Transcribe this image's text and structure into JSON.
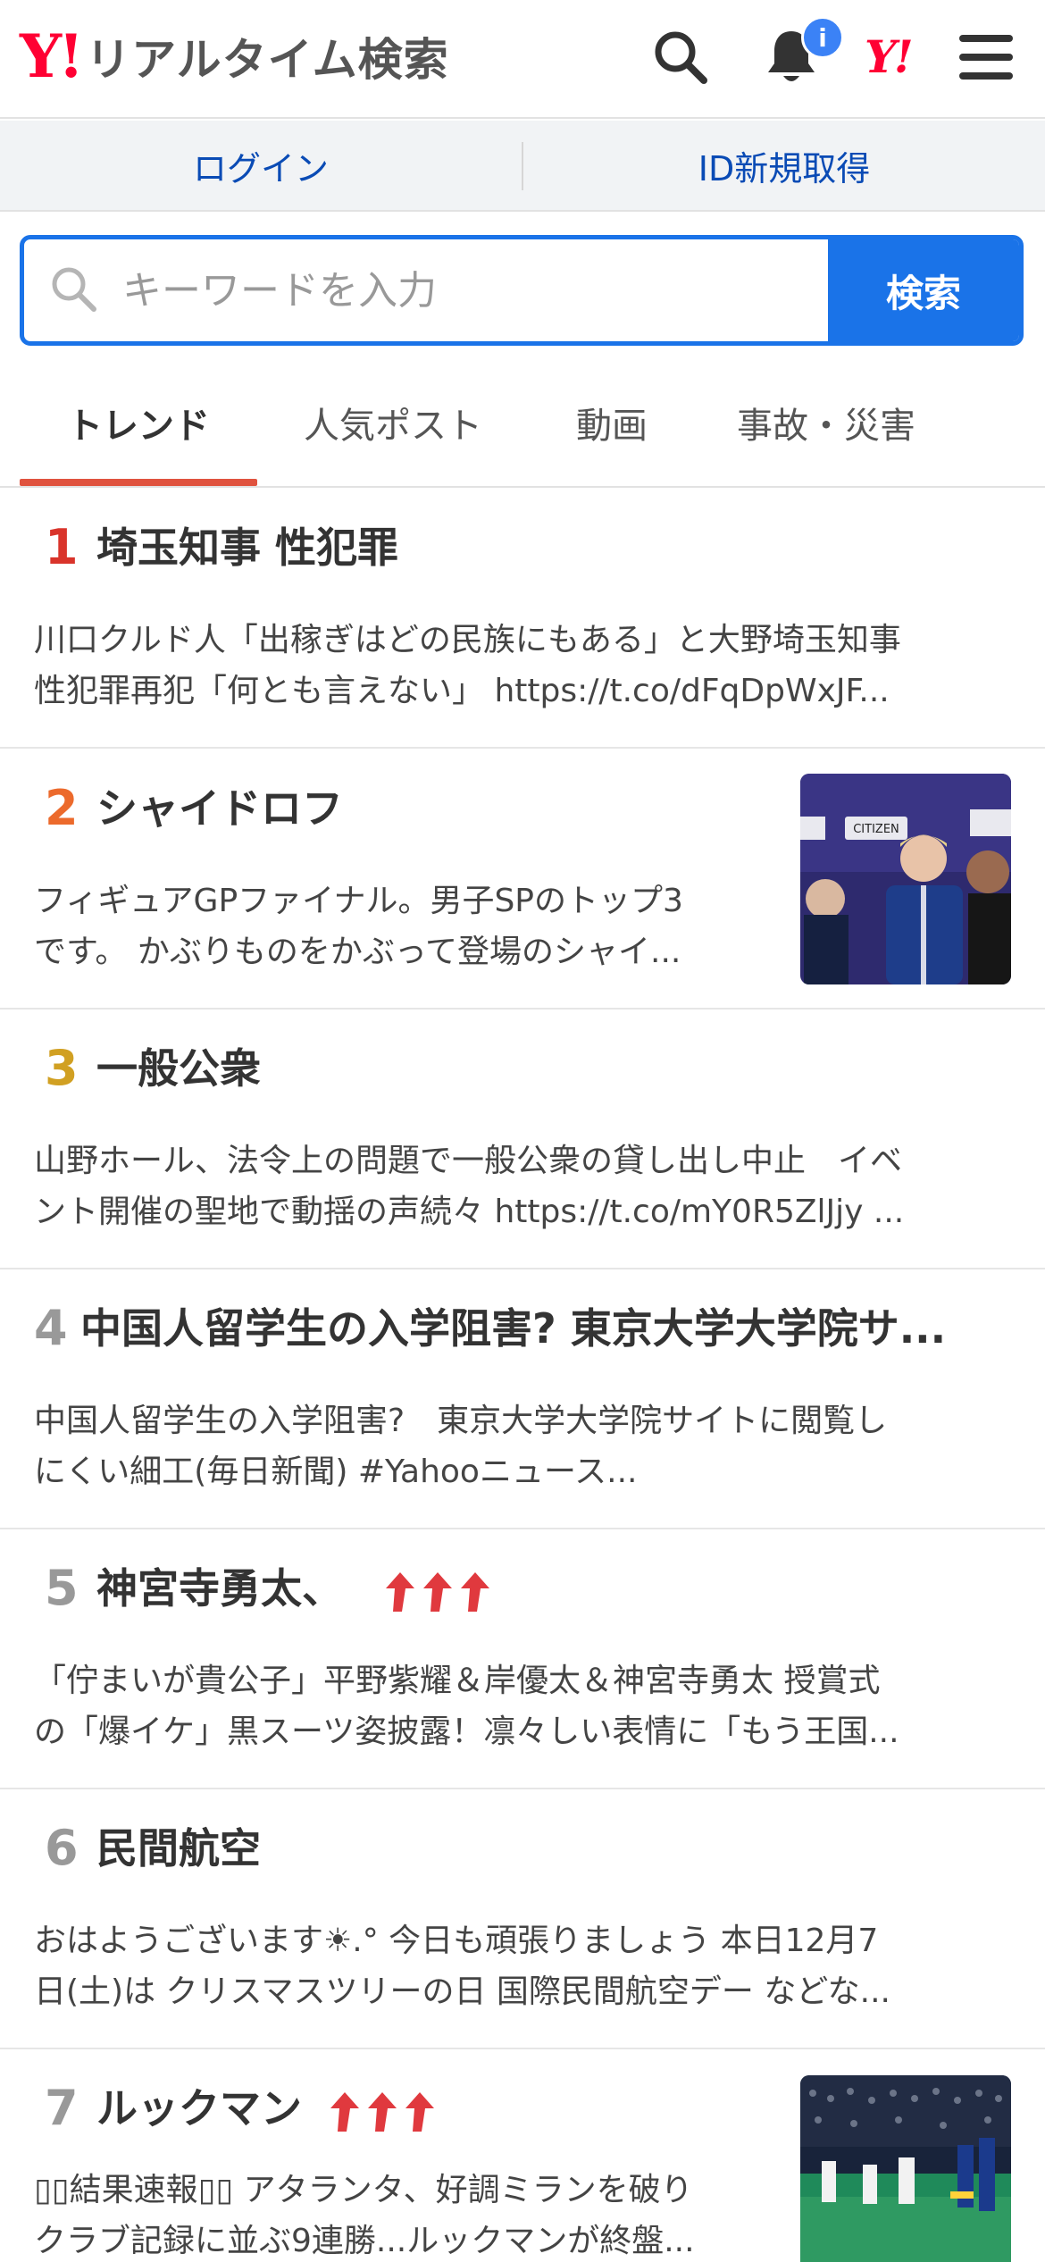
{
  "header": {
    "logo_mark": "Y!",
    "logo_text": "リアルタイム検索",
    "notification_badge": "i",
    "yahoo_small": "Y!"
  },
  "login": {
    "login_label": "ログイン",
    "register_label": "ID新規取得"
  },
  "search": {
    "placeholder": "キーワードを入力",
    "button_label": "検索"
  },
  "tabs": [
    {
      "label": "トレンド"
    },
    {
      "label": "人気ポスト"
    },
    {
      "label": "動画"
    },
    {
      "label": "事故・災害"
    }
  ],
  "trends": [
    {
      "rank": "1",
      "title": "埼玉知事 性犯罪",
      "lines": [
        "川口クルド人「出稼ぎはどの民族にもある」と大野埼玉知事",
        "性犯罪再犯「何とも言えない」 https://t.co/dFqDpWxJF..."
      ],
      "rank_color": "#d9342b"
    },
    {
      "rank": "2",
      "title": "シャイドロフ",
      "lines": [
        "フィギュアGPファイナル。男子SPのトップ3",
        "です。 かぶりものをかぶって登場のシャイ..."
      ],
      "rank_color": "#ec6a2c",
      "thumb_banner": "CITIZEN"
    },
    {
      "rank": "3",
      "title": "一般公衆",
      "lines": [
        "山野ホール、法令上の問題で一般公衆の貸し出し中止　イベ",
        "ント開催の聖地で動揺の声続々 https://t.co/mY0R5ZlJjy ..."
      ],
      "rank_color": "#d1a022"
    },
    {
      "rank": "4",
      "title": "中国人留学生の入学阻害? 東京大学大学院サ...",
      "lines": [
        "中国人留学生の入学阻害?　東京大学大学院サイトに閲覧し",
        "にくい細工(毎日新聞) #Yahooニュース..."
      ],
      "rank_color": "#999999"
    },
    {
      "rank": "5",
      "title": "神宮寺勇太、",
      "lines": [
        "「佇まいが貴公子」平野紫耀＆岸優太＆神宮寺勇太 授賞式",
        "の「爆イケ」黒スーツ姿披露！凛々しい表情に「もう王国..."
      ],
      "rank_color": "#999999"
    },
    {
      "rank": "6",
      "title": "民間航空",
      "lines": [
        "おはようございます☀.° 今日も頑張りましょう 本日12月7",
        "日(土)は クリスマスツリーの日 国際民間航空デー などな..."
      ],
      "rank_color": "#999999"
    },
    {
      "rank": "7",
      "title": "ルックマン",
      "lines": [
        "▯▯結果速報▯▯ アタランタ、好調ミランを破り",
        "クラブ記録に並ぶ9連勝...ルックマンが終盤..."
      ],
      "rank_color": "#999999"
    }
  ],
  "colors": {
    "accent_blue": "#1a73e8",
    "link_blue": "#0a4bb5",
    "yahoo_red": "#ff0033",
    "hot_arrow": "#e0393e",
    "tab_underline": "#e0533f"
  }
}
